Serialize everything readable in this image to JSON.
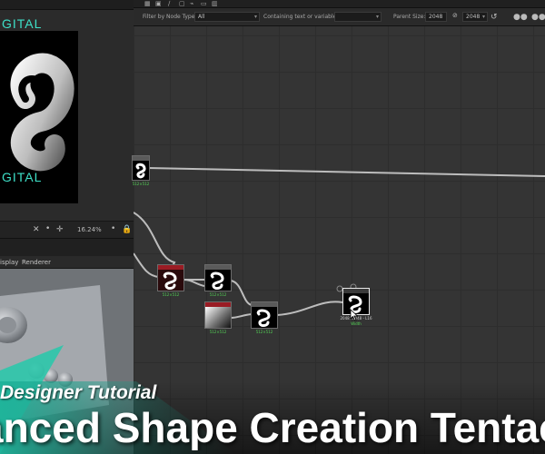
{
  "viewer2d": {
    "brand_top": "GITAL",
    "brand_bottom": "GITAL",
    "zoom": "16.24%"
  },
  "viewer3d": {
    "tabs": [
      "isplay",
      "Renderer"
    ]
  },
  "filter_bar": {
    "node_type_label": "Filter by Node Type",
    "node_type_value": "All",
    "text_label": "Containing text or variable:",
    "text_value": "",
    "parent_size_label": "Parent Size:",
    "parent_size_w": "2048",
    "parent_size_h": "2048"
  },
  "nodes": {
    "input_shape": {
      "caption": "512×512"
    },
    "warp": {
      "caption": "512×512"
    },
    "blend_top": {
      "caption": "512×512"
    },
    "gradient": {
      "caption": "512×512"
    },
    "blend_bottom": {
      "caption": "512×512"
    },
    "output": {
      "caption": "2048×2048 - L16",
      "sub": "Width"
    }
  },
  "overlay": {
    "subtitle": "Designer Tutorial",
    "title": "anced Shape Creation Tentac"
  },
  "colors": {
    "accent_teal": "#3ee0c8",
    "node_red_header": "#9a1c24",
    "caption_green": "#54d456"
  }
}
